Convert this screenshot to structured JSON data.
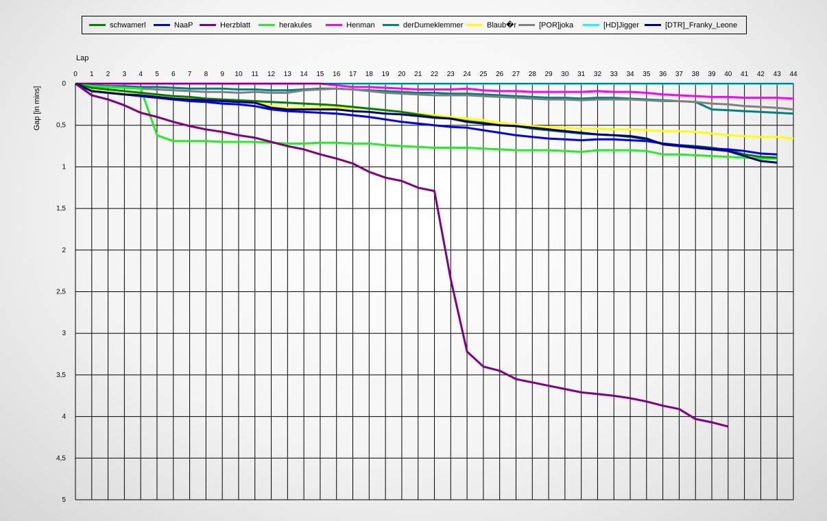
{
  "chart_data": {
    "type": "line",
    "xlabel": "Lap",
    "ylabel": "Gap [in mins]",
    "xlim": [
      0,
      44
    ],
    "ylim": [
      0,
      5
    ],
    "y_inverted": true,
    "grid": true,
    "legend_position": "top",
    "x_ticks": [
      "0",
      "1",
      "2",
      "3",
      "4",
      "5",
      "6",
      "7",
      "8",
      "9",
      "10",
      "11",
      "12",
      "13",
      "14",
      "15",
      "16",
      "17",
      "18",
      "19",
      "20",
      "21",
      "22",
      "23",
      "24",
      "25",
      "26",
      "27",
      "28",
      "29",
      "30",
      "31",
      "32",
      "33",
      "34",
      "35",
      "36",
      "37",
      "38",
      "39",
      "40",
      "41",
      "42",
      "43",
      "44"
    ],
    "y_ticks": [
      "0",
      "0,5",
      "1",
      "1,5",
      "2",
      "2,5",
      "3",
      "3,5",
      "4",
      "4,5",
      "5"
    ],
    "series": [
      {
        "name": "schwamerl",
        "color": "#008000",
        "x": [
          0,
          1,
          2,
          3,
          4,
          5,
          6,
          7,
          8,
          9,
          10,
          11,
          12,
          13,
          14,
          15,
          16,
          17,
          18,
          19,
          20,
          21,
          22,
          23,
          24,
          25,
          26,
          27,
          28,
          29,
          30,
          31,
          32,
          33,
          34,
          35,
          36,
          37,
          38,
          39,
          40,
          41,
          42,
          43
        ],
        "values": [
          0,
          0.05,
          0.07,
          0.09,
          0.11,
          0.13,
          0.15,
          0.16,
          0.18,
          0.19,
          0.2,
          0.21,
          0.22,
          0.23,
          0.24,
          0.25,
          0.26,
          0.28,
          0.3,
          0.32,
          0.34,
          0.37,
          0.4,
          0.42,
          0.45,
          0.47,
          0.5,
          0.51,
          0.54,
          0.56,
          0.58,
          0.6,
          0.61,
          0.62,
          0.64,
          0.67,
          0.72,
          0.74,
          0.75,
          0.77,
          0.8,
          0.85,
          0.88,
          0.89
        ]
      },
      {
        "name": "NaaP",
        "color": "#0000ee",
        "x": [
          0,
          1,
          2,
          3,
          4,
          5,
          6,
          7,
          8,
          9,
          10,
          11,
          12,
          13,
          14,
          15,
          16,
          17,
          18,
          19,
          20,
          21,
          22,
          23,
          24,
          25,
          26,
          27,
          28,
          29,
          30,
          31,
          32,
          33,
          34,
          35,
          36,
          37,
          38,
          39,
          40,
          41,
          42,
          43
        ],
        "values": [
          0,
          0.09,
          0.11,
          0.13,
          0.15,
          0.17,
          0.19,
          0.21,
          0.22,
          0.24,
          0.25,
          0.27,
          0.31,
          0.33,
          0.34,
          0.35,
          0.36,
          0.38,
          0.4,
          0.43,
          0.46,
          0.48,
          0.5,
          0.52,
          0.53,
          0.56,
          0.59,
          0.62,
          0.64,
          0.66,
          0.67,
          0.68,
          0.67,
          0.67,
          0.68,
          0.69,
          0.72,
          0.74,
          0.76,
          0.78,
          0.79,
          0.81,
          0.84,
          0.85
        ]
      },
      {
        "name": "Herzblatt",
        "color": "#800080",
        "x": [
          0,
          1,
          2,
          3,
          4,
          5,
          6,
          7,
          8,
          9,
          10,
          11,
          12,
          13,
          14,
          15,
          16,
          17,
          18,
          19,
          20,
          21,
          22,
          23,
          24,
          25,
          26,
          27,
          28,
          29,
          30,
          31,
          32,
          33,
          34,
          35,
          36,
          37,
          38,
          39,
          40
        ],
        "values": [
          0,
          0.14,
          0.19,
          0.26,
          0.35,
          0.4,
          0.46,
          0.51,
          0.55,
          0.58,
          0.62,
          0.65,
          0.7,
          0.75,
          0.79,
          0.85,
          0.9,
          0.96,
          1.06,
          1.13,
          1.17,
          1.25,
          1.29,
          2.35,
          3.22,
          3.4,
          3.45,
          3.55,
          3.59,
          3.63,
          3.67,
          3.71,
          3.73,
          3.75,
          3.78,
          3.82,
          3.87,
          3.91,
          4.03,
          4.07,
          4.12
        ]
      },
      {
        "name": "herakules",
        "color": "#22ee22",
        "x": [
          0,
          1,
          2,
          3,
          4,
          5,
          6,
          7,
          8,
          9,
          10,
          11,
          12,
          13,
          14,
          15,
          16,
          17,
          18,
          19,
          20,
          21,
          22,
          23,
          24,
          25,
          26,
          27,
          28,
          29,
          30,
          31,
          32,
          33,
          34,
          35,
          36,
          37,
          38,
          39,
          40,
          41,
          42,
          43
        ],
        "values": [
          0,
          0.03,
          0.04,
          0.05,
          0.06,
          0.62,
          0.69,
          0.69,
          0.69,
          0.7,
          0.7,
          0.7,
          0.71,
          0.72,
          0.72,
          0.71,
          0.71,
          0.72,
          0.72,
          0.74,
          0.75,
          0.76,
          0.77,
          0.77,
          0.77,
          0.78,
          0.79,
          0.8,
          0.8,
          0.8,
          0.81,
          0.82,
          0.8,
          0.8,
          0.8,
          0.81,
          0.85,
          0.85,
          0.86,
          0.87,
          0.88,
          0.89,
          0.9,
          0.9
        ]
      },
      {
        "name": "Henman",
        "color": "#ff00ff",
        "x": [
          0,
          1,
          2,
          3,
          4,
          5,
          6,
          7,
          8,
          9,
          10,
          11,
          12,
          13,
          14,
          15,
          16,
          17,
          18,
          19,
          20,
          21,
          22,
          23,
          24,
          25,
          26,
          27,
          28,
          29,
          30,
          31,
          32,
          33,
          34,
          35,
          36,
          37,
          38,
          39,
          40,
          41,
          42,
          43,
          44
        ],
        "values": [
          0,
          0,
          0,
          0,
          0,
          0,
          0,
          0,
          0,
          0,
          0,
          0,
          0,
          0,
          0,
          0,
          0.02,
          0.04,
          0.04,
          0.05,
          0.06,
          0.07,
          0.07,
          0.07,
          0.06,
          0.08,
          0.09,
          0.09,
          0.1,
          0.1,
          0.1,
          0.1,
          0.09,
          0.1,
          0.1,
          0.11,
          0.13,
          0.14,
          0.15,
          0.16,
          0.16,
          0.17,
          0.17,
          0.17,
          0.18
        ]
      },
      {
        "name": "derDumeklemmer",
        "color": "#008080",
        "x": [
          0,
          1,
          2,
          3,
          4,
          5,
          6,
          7,
          8,
          9,
          10,
          11,
          12,
          13,
          14,
          15,
          16,
          17,
          18,
          19,
          20,
          21,
          22,
          23,
          24,
          25,
          26,
          27,
          28,
          29,
          30,
          31,
          32,
          33,
          34,
          35,
          36,
          37,
          38,
          39,
          40,
          41,
          42,
          43,
          44
        ],
        "values": [
          0,
          0.02,
          0.03,
          0.03,
          0.04,
          0.04,
          0.05,
          0.06,
          0.06,
          0.06,
          0.07,
          0.07,
          0.08,
          0.08,
          0.07,
          0.06,
          0.06,
          0.07,
          0.08,
          0.09,
          0.1,
          0.11,
          0.11,
          0.12,
          0.12,
          0.13,
          0.14,
          0.15,
          0.16,
          0.17,
          0.17,
          0.18,
          0.17,
          0.17,
          0.18,
          0.19,
          0.2,
          0.21,
          0.22,
          0.31,
          0.32,
          0.33,
          0.34,
          0.35,
          0.36
        ]
      },
      {
        "name": "Blaub�r",
        "color": "#ffff00",
        "x": [
          0,
          1,
          2,
          3,
          4,
          5,
          6,
          7,
          8,
          9,
          10,
          11,
          12,
          13,
          14,
          15,
          16,
          17,
          18,
          19,
          20,
          21,
          22,
          23,
          24,
          25,
          26,
          27,
          28,
          29,
          30,
          31,
          32,
          33,
          34,
          35,
          36,
          37,
          38,
          39,
          40,
          41,
          42,
          43,
          44
        ],
        "values": [
          0,
          0.08,
          0.1,
          0.12,
          0.13,
          0.15,
          0.17,
          0.18,
          0.19,
          0.2,
          0.21,
          0.22,
          0.27,
          0.29,
          0.29,
          0.29,
          0.29,
          0.29,
          0.3,
          0.32,
          0.34,
          0.36,
          0.38,
          0.4,
          0.42,
          0.44,
          0.47,
          0.49,
          0.51,
          0.52,
          0.53,
          0.54,
          0.54,
          0.55,
          0.55,
          0.56,
          0.57,
          0.57,
          0.58,
          0.6,
          0.62,
          0.63,
          0.64,
          0.64,
          0.66
        ]
      },
      {
        "name": "[POR]joka",
        "color": "#808080",
        "x": [
          0,
          1,
          2,
          3,
          4,
          5,
          6,
          7,
          8,
          9,
          10,
          11,
          12,
          13,
          14,
          15,
          16,
          17,
          18,
          19,
          20,
          21,
          22,
          23,
          24,
          25,
          26,
          27,
          28,
          29,
          30,
          31,
          32,
          33,
          34,
          35,
          36,
          37,
          38,
          39,
          40,
          41,
          42,
          43,
          44
        ],
        "values": [
          0,
          0.03,
          0.04,
          0.05,
          0.06,
          0.07,
          0.08,
          0.09,
          0.1,
          0.1,
          0.11,
          0.1,
          0.11,
          0.11,
          0.08,
          0.07,
          0.06,
          0.07,
          0.09,
          0.11,
          0.12,
          0.13,
          0.14,
          0.14,
          0.14,
          0.15,
          0.16,
          0.17,
          0.18,
          0.19,
          0.19,
          0.2,
          0.19,
          0.19,
          0.19,
          0.2,
          0.21,
          0.21,
          0.22,
          0.24,
          0.25,
          0.27,
          0.28,
          0.29,
          0.31
        ]
      },
      {
        "name": "[HD]Jigger",
        "color": "#00ffff",
        "x": [
          0,
          1,
          2,
          3,
          4,
          5,
          6,
          7,
          8,
          9,
          10,
          11,
          12,
          13,
          14,
          15,
          16,
          17,
          18,
          19,
          20,
          21,
          22,
          23,
          24,
          25,
          26,
          27,
          28,
          29,
          30,
          31,
          32,
          33,
          34,
          35,
          36,
          37,
          38,
          39,
          40,
          41,
          42,
          43,
          44
        ],
        "values": [
          0,
          0,
          0,
          0,
          0,
          0,
          0,
          0,
          0,
          0,
          0,
          0,
          0,
          0,
          0,
          0,
          0,
          0,
          0,
          0,
          0,
          0,
          0,
          0,
          0,
          0,
          0,
          0,
          0,
          0,
          0,
          0,
          0,
          0,
          0,
          0,
          0,
          0,
          0,
          0,
          0,
          0,
          0,
          0,
          0
        ]
      },
      {
        "name": "[DTR]_Franky_Leone",
        "color": "#000080",
        "x": [
          0,
          1,
          2,
          3,
          4,
          5,
          6,
          7,
          8,
          9,
          10,
          11,
          12,
          13,
          14,
          15,
          16,
          17,
          18,
          19,
          20,
          21,
          22,
          23,
          24,
          25,
          26,
          27,
          28,
          29,
          30,
          31,
          32,
          33,
          34,
          35,
          36,
          37,
          38,
          39,
          40,
          41,
          42,
          43
        ],
        "values": [
          0,
          0.09,
          0.11,
          0.13,
          0.14,
          0.16,
          0.18,
          0.19,
          0.2,
          0.21,
          0.22,
          0.23,
          0.29,
          0.31,
          0.31,
          0.31,
          0.31,
          0.33,
          0.34,
          0.36,
          0.37,
          0.39,
          0.41,
          0.42,
          0.46,
          0.48,
          0.5,
          0.51,
          0.53,
          0.55,
          0.57,
          0.59,
          0.61,
          0.62,
          0.63,
          0.66,
          0.73,
          0.75,
          0.77,
          0.79,
          0.81,
          0.87,
          0.93,
          0.95
        ]
      }
    ]
  }
}
